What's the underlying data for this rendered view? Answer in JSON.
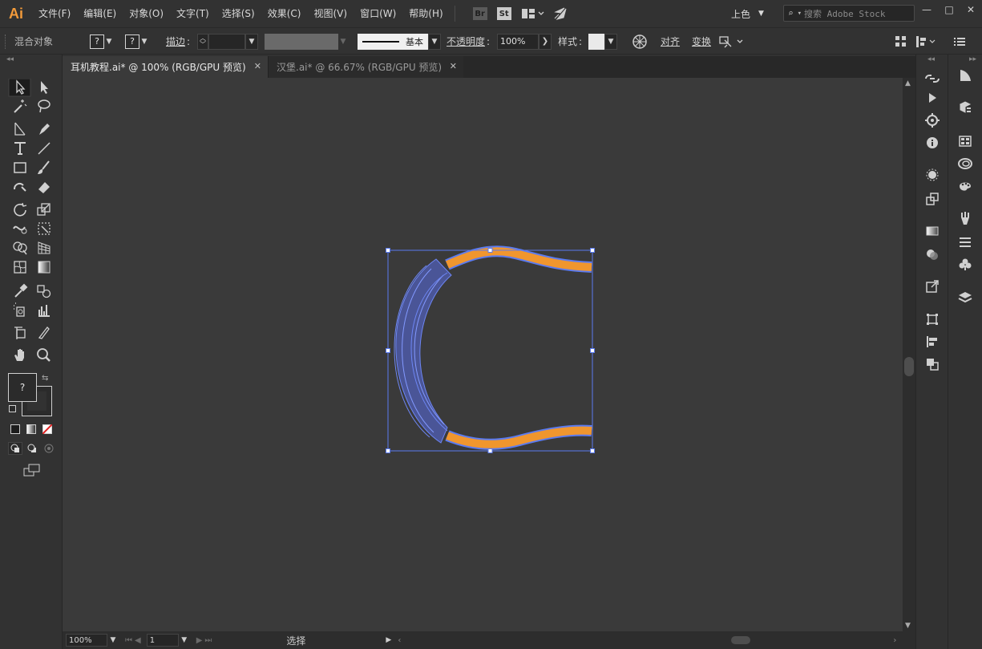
{
  "app": {
    "logo": "Ai",
    "brand_color": "#f29a3a",
    "accent_selection": "#5b7bf0",
    "stroke_fill_color": "#f0962e"
  },
  "menu": {
    "items": [
      "文件(F)",
      "编辑(E)",
      "对象(O)",
      "文字(T)",
      "选择(S)",
      "效果(C)",
      "视图(V)",
      "窗口(W)",
      "帮助(H)"
    ],
    "bridge_badge": "Br",
    "stock_badge": "St",
    "workspace": "上色",
    "search_placeholder": "搜索 Adobe Stock"
  },
  "window_controls": {
    "minimize": "—",
    "maximize": "□",
    "close": "✕"
  },
  "control_bar": {
    "selection_label": "混合对象",
    "fill_value": "?",
    "stroke_value": "?",
    "stroke_label": "描边",
    "stroke_weight": "",
    "brush_profile": "基本",
    "opacity_label": "不透明度",
    "opacity_value": "100%",
    "style_label": "样式",
    "align_label": "对齐",
    "transform_label": "变换"
  },
  "tabs": [
    {
      "title": "耳机教程.ai* @ 100% (RGB/GPU 预览)",
      "close": "✕",
      "active": true
    },
    {
      "title": "汉堡.ai* @ 66.67% (RGB/GPU 预览)",
      "close": "✕",
      "active": false
    }
  ],
  "toolbar": {
    "fill_stroke_label": "?",
    "tools": [
      "selection-tool",
      "direct-selection-tool",
      "magic-wand-tool",
      "lasso-tool",
      "line-tool",
      "pen-tool",
      "type-tool",
      "line-segment-tool",
      "rectangle-tool",
      "paintbrush-tool",
      "shaper-tool",
      "eraser-tool",
      "rotate-tool",
      "scale-tool",
      "warp-tool",
      "free-transform-tool",
      "shape-builder-tool",
      "perspective-grid-tool",
      "mesh-tool",
      "gradient-tool",
      "eyedropper-tool",
      "blend-tool",
      "symbol-sprayer-tool",
      "column-graph-tool",
      "artboard-tool",
      "slice-tool",
      "hand-tool",
      "zoom-tool"
    ]
  },
  "status": {
    "zoom": "100%",
    "artboard_number": "1",
    "tool_status": "选择"
  },
  "right_panels": {
    "column1": [
      "links-icon",
      "actions-play-icon",
      "libraries-icon",
      "info-icon",
      "brushes-icon",
      "asset-export-icon",
      "gradient-icon",
      "transparency-icon",
      "export-icon",
      "transform-icon",
      "align-icon",
      "pathfinder-icon"
    ],
    "column2": [
      "color-guide-icon",
      "cc-libraries-icon",
      "swatches-icon",
      "appearance-icon",
      "color-icon",
      "brush-icon",
      "stroke-icon",
      "symbols-icon",
      "layers-icon"
    ]
  }
}
